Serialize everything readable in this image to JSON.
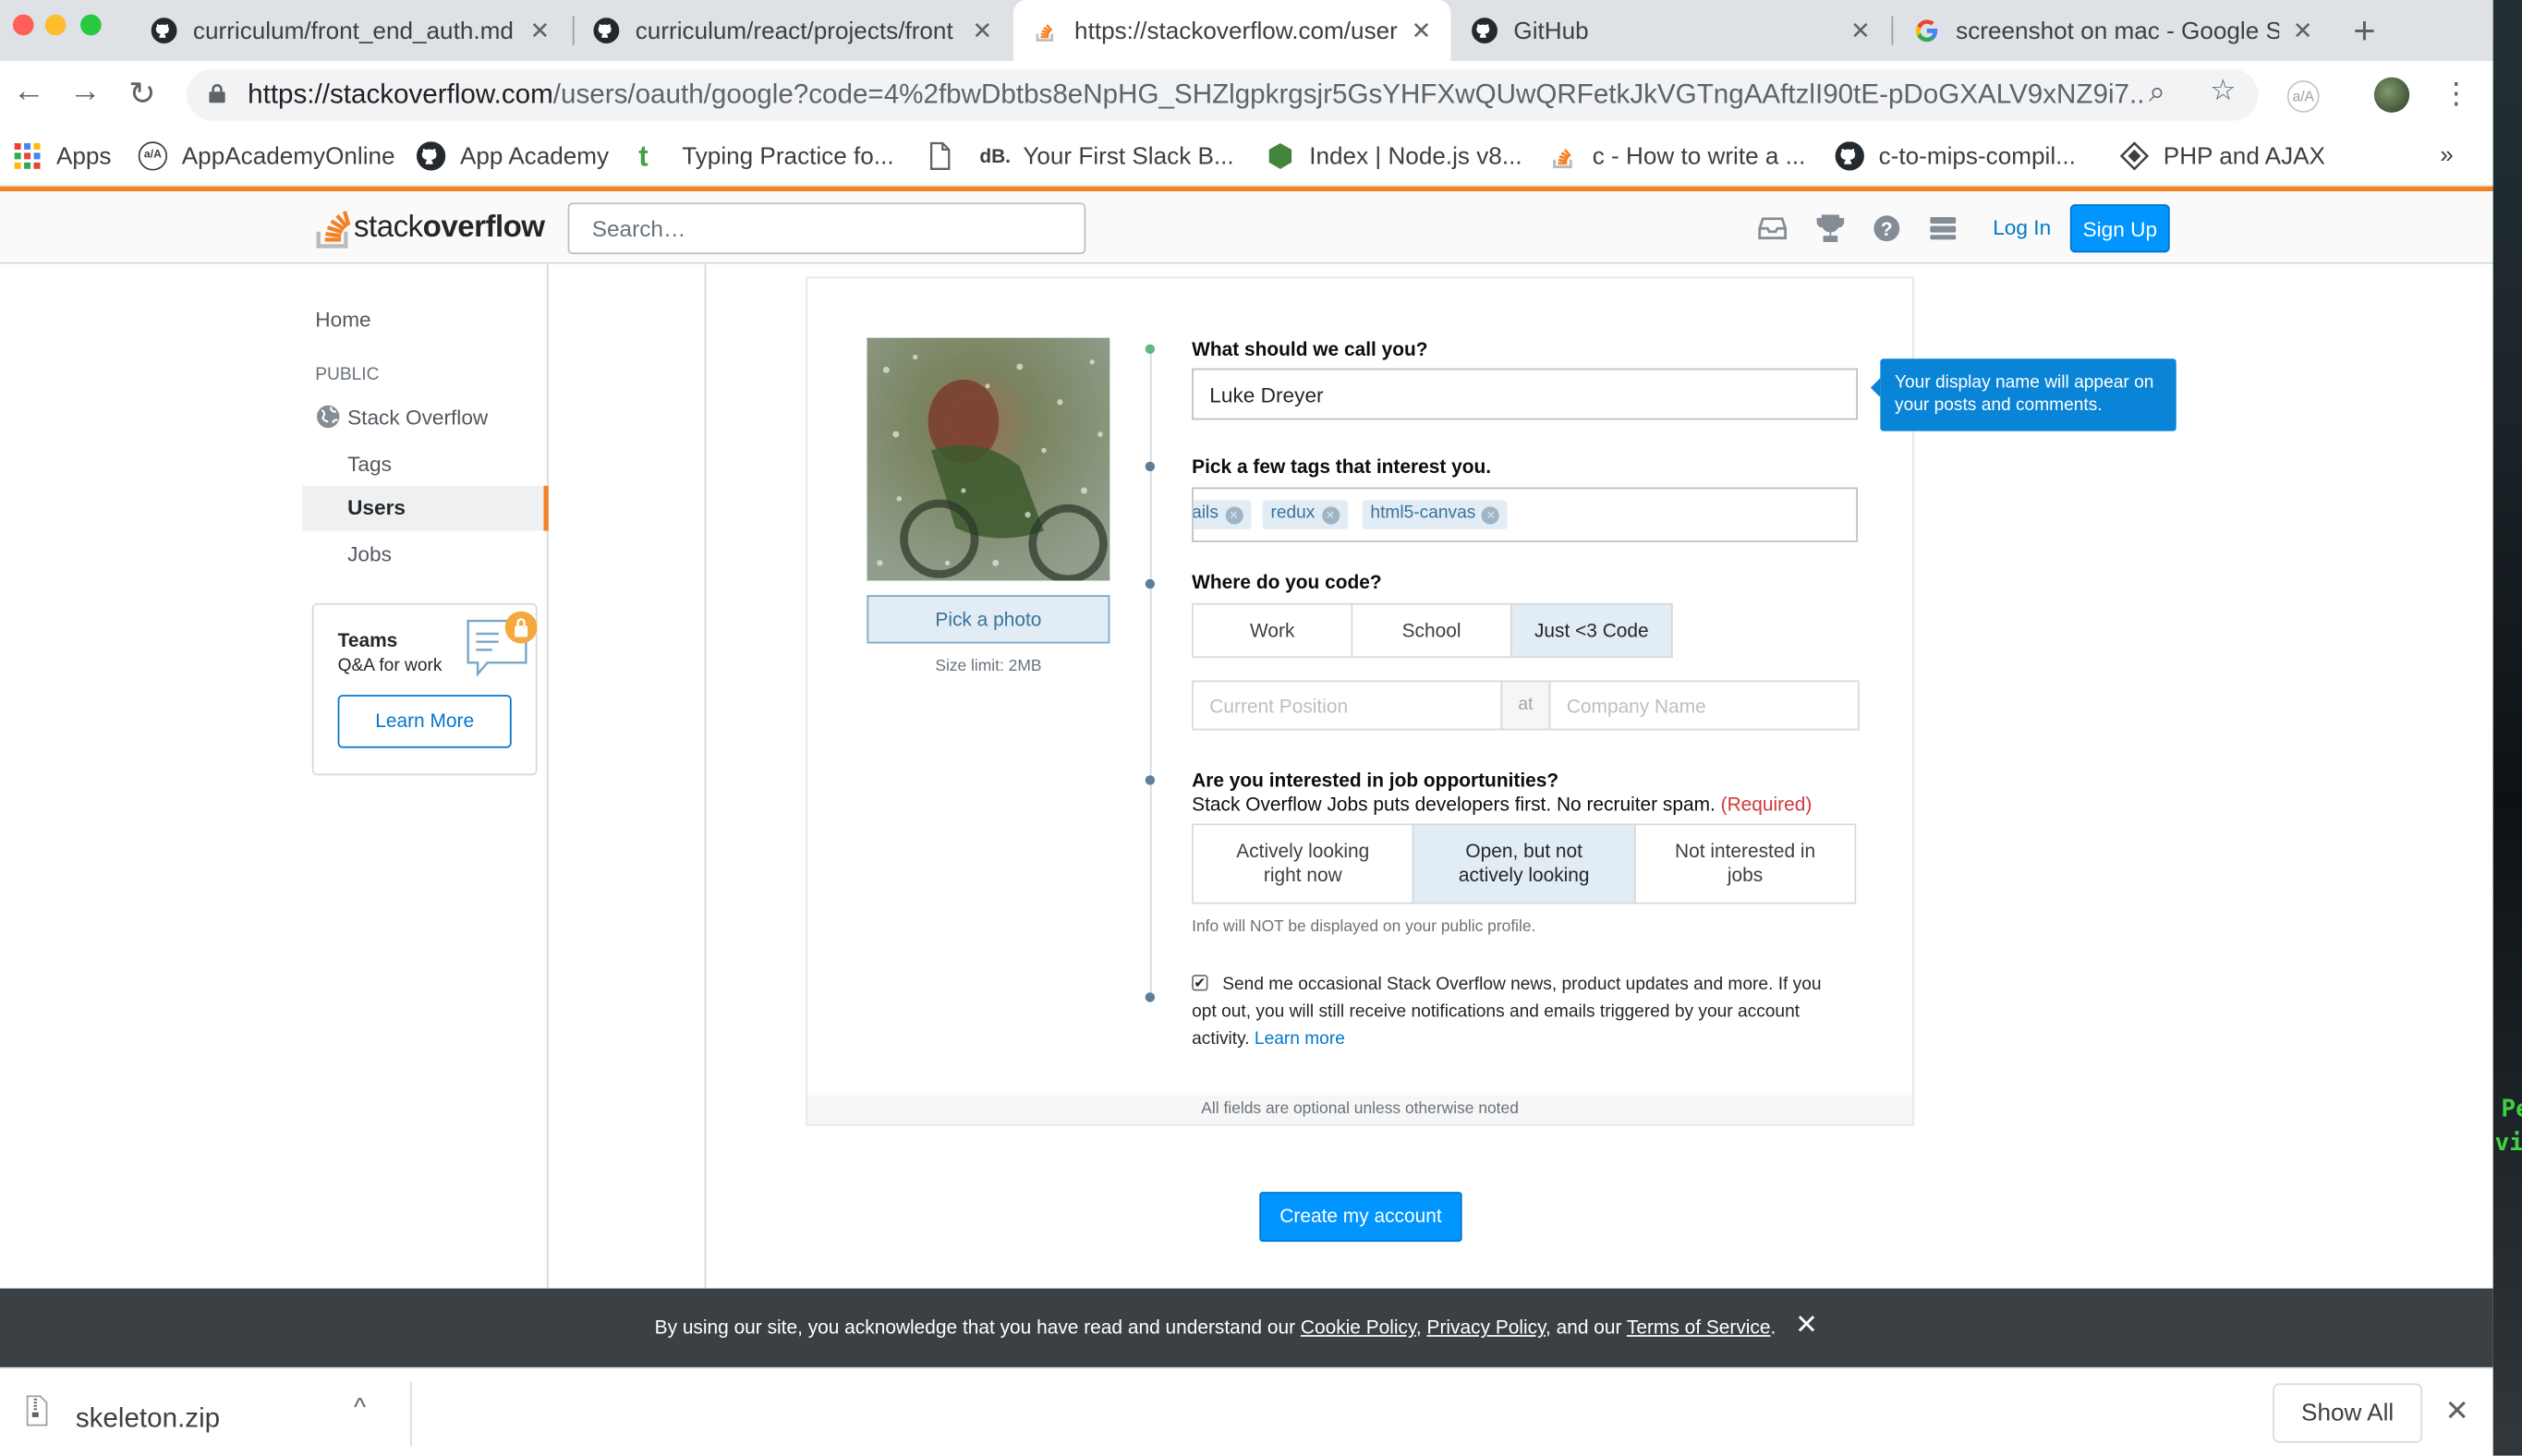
{
  "colors": {
    "so_orange": "#f48024",
    "so_blue": "#0095ff",
    "link_blue": "#0077cc",
    "tooltip_blue": "#0a84d6",
    "required_red": "#d1383d",
    "cookie_bg": "#3b4045"
  },
  "browser": {
    "tabs": [
      {
        "title": "curriculum/front_end_auth.md",
        "icon": "github-icon"
      },
      {
        "title": "curriculum/react/projects/front",
        "icon": "github-icon"
      },
      {
        "title": "https://stackoverflow.com/users/oauth",
        "icon": "stackoverflow-icon"
      },
      {
        "title": "GitHub",
        "icon": "github-icon"
      },
      {
        "title": "screenshot on mac - Google Search",
        "icon": "google-icon"
      }
    ],
    "url_host": "https://stackoverflow.com",
    "url_path": "/users/oauth/google?code=4%2fbwDbtbs8eNpHG_SHZlgpkrgsjr5GsYHFXwQUwQRFetkJkVGTngAAftzlI90tE-pDoGXALV9xNZ9i7...",
    "bookmarks": [
      {
        "label": "Apps",
        "icon": "apps-grid-icon"
      },
      {
        "label": "AppAcademyOnline",
        "icon": "appacademy-icon"
      },
      {
        "label": "App Academy",
        "icon": "github-icon"
      },
      {
        "label": "Typing Practice fo...",
        "icon": "typing-icon"
      },
      {
        "label": "",
        "icon": "document-icon"
      },
      {
        "label": "Your First Slack B...",
        "icon": "db-icon"
      },
      {
        "label": "Index | Node.js v8...",
        "icon": "nodejs-icon"
      },
      {
        "label": "c - How to write a ...",
        "icon": "stackoverflow-icon"
      },
      {
        "label": "c-to-mips-compil...",
        "icon": "github-icon"
      },
      {
        "label": "PHP and AJAX",
        "icon": "diamond-icon"
      }
    ],
    "bookmarks_overflow": "»",
    "ext_badge": "a/A"
  },
  "so_header": {
    "logo_light": "stack",
    "logo_bold": "overflow",
    "search_placeholder": "Search…",
    "login": "Log In",
    "signup": "Sign Up"
  },
  "left_nav": {
    "home": "Home",
    "public": "PUBLIC",
    "stack_overflow": "Stack Overflow",
    "tags": "Tags",
    "users": "Users",
    "jobs": "Jobs",
    "teams_title": "Teams",
    "teams_sub": "Q&A for work",
    "teams_button": "Learn More"
  },
  "form": {
    "pick_photo": "Pick a photo",
    "size_limit": "Size limit: 2MB",
    "name_label": "What should we call you?",
    "name_value": "Luke Dreyer",
    "tooltip": "Your display name will appear on your posts and comments.",
    "tags_label": "Pick a few tags that interest you.",
    "tags": [
      "ails",
      "redux",
      "html5-canvas"
    ],
    "tag_remove": "×",
    "where_label": "Where do you code?",
    "where_options": [
      "Work",
      "School",
      "Just <3 Code"
    ],
    "where_selected": "Just <3 Code",
    "position_placeholder": "Current Position",
    "at": "at",
    "company_placeholder": "Company Name",
    "jobs_label": "Are you interested in job opportunities?",
    "jobs_desc": "Stack Overflow Jobs puts developers first. No recruiter spam.",
    "jobs_required": "(Required)",
    "jobs_options": [
      "Actively looking right now",
      "Open, but not actively looking",
      "Not interested in jobs"
    ],
    "jobs_selected": "Open, but not actively looking",
    "public_note": "Info will NOT be displayed on your public profile.",
    "optin_checked": true,
    "optin_check_mark": "✔",
    "optin_text": "Send me occasional Stack Overflow news, product updates and more. If you opt out, you will still receive notifications and emails triggered by your account activity.",
    "optin_link": "Learn more",
    "footer_note": "All fields are optional unless otherwise noted",
    "create_button": "Create my account"
  },
  "cookie_bar": {
    "text_before": "By using our site, you acknowledge that you have read and understand our ",
    "cookie_policy": "Cookie Policy",
    "comma": ", ",
    "privacy_policy": "Privacy Policy",
    "and_our": ", and our ",
    "terms": "Terms of Service",
    "period": ".",
    "close": "✕"
  },
  "downloads": {
    "file": "skeleton.zip",
    "caret": "^",
    "show_all": "Show All",
    "close": "✕"
  },
  "desktop_edge": {
    "line1": "Pe",
    "line2": "vi"
  }
}
